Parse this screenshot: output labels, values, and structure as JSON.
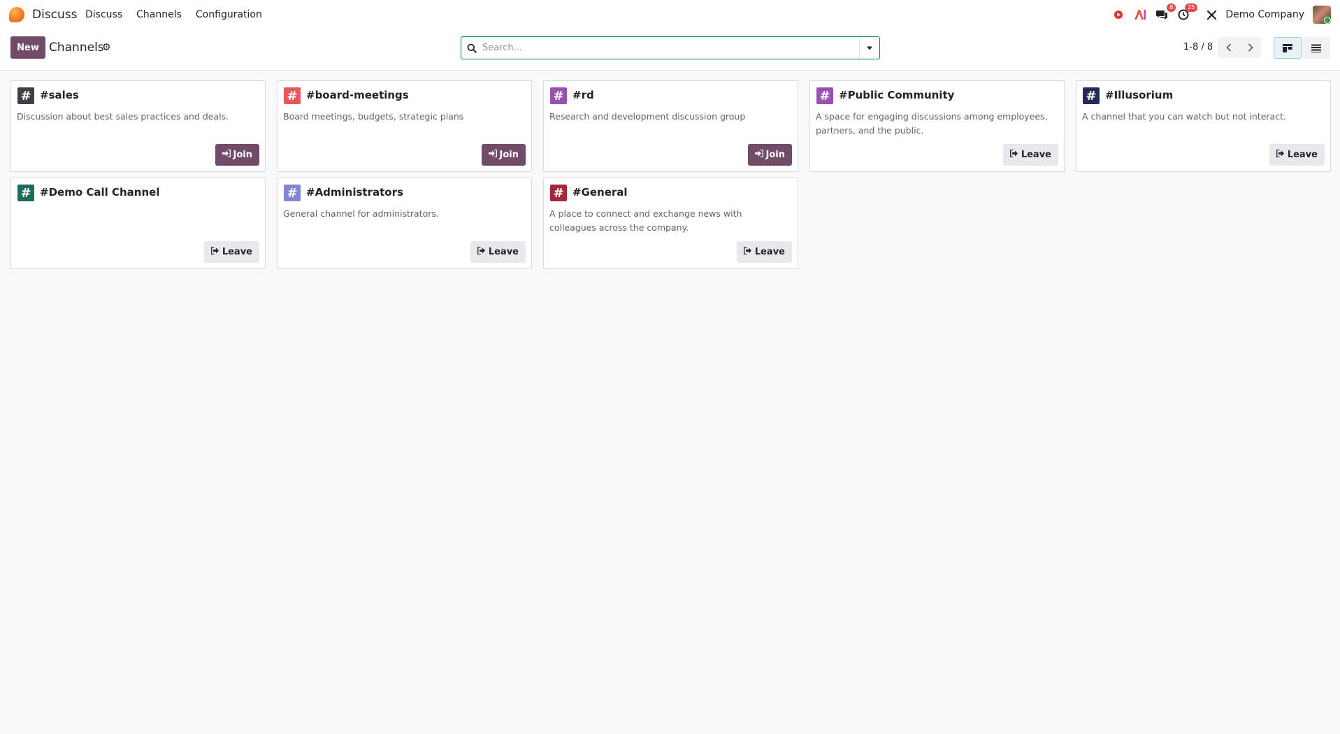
{
  "navbar": {
    "app_name": "Discuss",
    "menu": [
      {
        "label": "Discuss"
      },
      {
        "label": "Channels"
      },
      {
        "label": "Configuration"
      }
    ],
    "systray": {
      "messages_badge": "8",
      "activities_badge": "25",
      "company": "Demo Company"
    }
  },
  "control_panel": {
    "new_label": "New",
    "title": "Channels",
    "search_placeholder": "Search...",
    "pager": "1-8 / 8"
  },
  "colors": {
    "brand": "#714b67",
    "search_border": "#017e84"
  },
  "channels": [
    {
      "name": "#sales",
      "description": "Discussion about best sales practices and deals.",
      "action": "Join",
      "icon_color": "#3f3f48"
    },
    {
      "name": "#board-meetings",
      "description": "Board meetings, budgets, strategic plans",
      "action": "Join",
      "icon_color": "#e8575a"
    },
    {
      "name": "#rd",
      "description": "Research and development discussion group",
      "action": "Join",
      "icon_color": "#9b4fb0"
    },
    {
      "name": "#Public Community",
      "description": "A space for engaging discussions among employees, partners, and the public.",
      "action": "Leave",
      "icon_color": "#9b4fb0"
    },
    {
      "name": "#Illusorium",
      "description": "A channel that you can watch but not interact.",
      "action": "Leave",
      "icon_color": "#232a57"
    },
    {
      "name": "#Demo Call Channel",
      "description": "",
      "action": "Leave",
      "icon_color": "#1f6b5a"
    },
    {
      "name": "#Administrators",
      "description": "General channel for administrators.",
      "action": "Leave",
      "icon_color": "#7f86d6"
    },
    {
      "name": "#General",
      "description": "A place to connect and exchange news with colleagues across the company.",
      "action": "Leave",
      "icon_color": "#a3283a"
    }
  ]
}
